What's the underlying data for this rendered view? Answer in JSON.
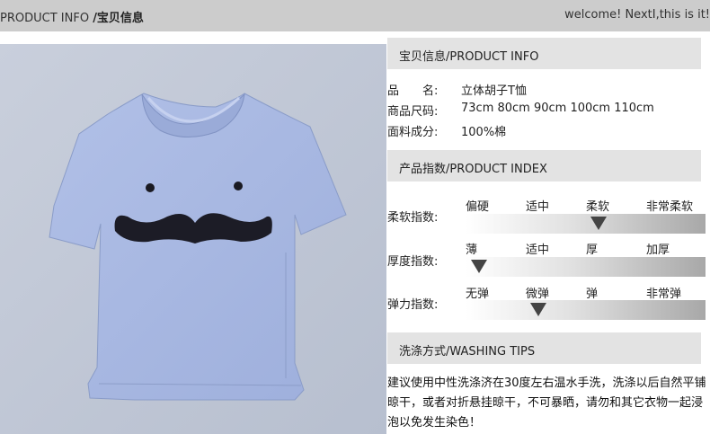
{
  "header": {
    "title_en": "PRODUCT INFO ",
    "title_cn": "/宝贝信息",
    "welcome": "welcome! NextI,this is it!"
  },
  "product_photo": {
    "description_icon": "tshirt-with-mustache-icon",
    "shirt_color": "#a9b9e3",
    "background_color": "#c3c9d7"
  },
  "sections": {
    "product_info": "宝贝信息/PRODUCT INFO",
    "product_index": "产品指数/PRODUCT INDEX",
    "washing_tips": "洗涤方式/WASHING TIPS"
  },
  "info": [
    {
      "label": "品　　名:",
      "value": "立体胡子T恤"
    },
    {
      "label": "商品尺码:",
      "value": "73cm 80cm 90cm 100cm 110cm"
    },
    {
      "label": "面料成分:",
      "value": "100%棉"
    }
  ],
  "indices": [
    {
      "label": "柔软指数:",
      "levels": [
        "偏硬",
        "适中",
        "柔软",
        "非常柔软"
      ],
      "selected_index": 2
    },
    {
      "label": "厚度指数:",
      "levels": [
        "薄",
        "适中",
        "厚",
        "加厚"
      ],
      "selected_index": 0
    },
    {
      "label": "弹力指数:",
      "levels": [
        "无弹",
        "微弹",
        "弹",
        "非常弹"
      ],
      "selected_index": 1
    }
  ],
  "washing_text": "建议使用中性洗涤济在30度左右温水手洗，洗涤以后自然平铺晾干，或者对折悬挂晾干，不可暴晒，请勿和其它衣物一起浸泡以免发生染色！"
}
